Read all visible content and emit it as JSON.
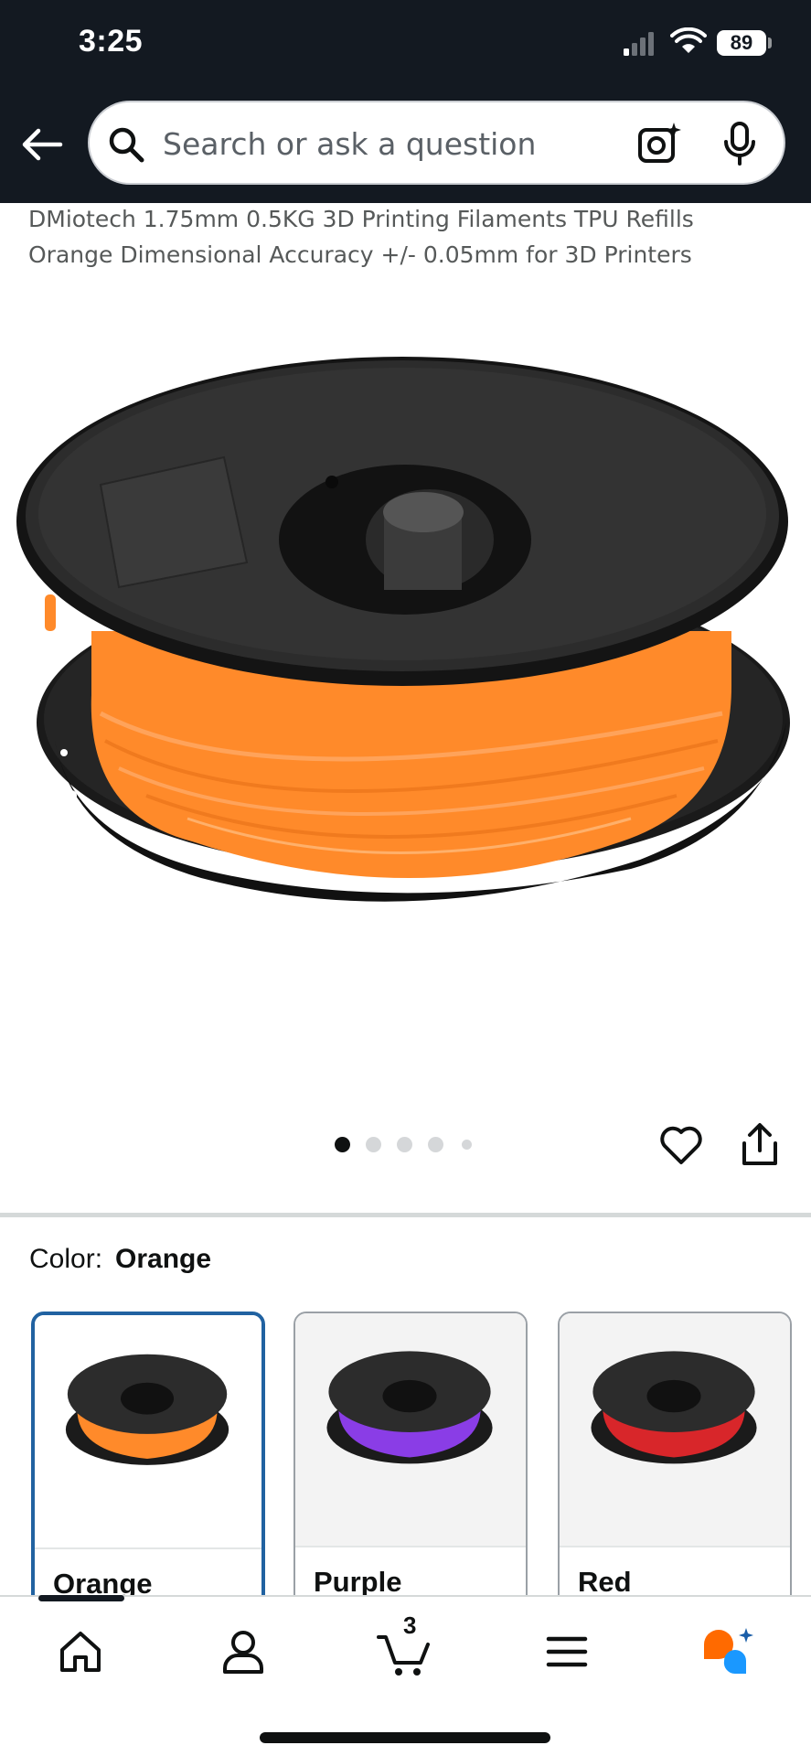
{
  "status_bar": {
    "time": "3:25",
    "battery": "89"
  },
  "search": {
    "placeholder": "Search or ask a question",
    "value": ""
  },
  "product": {
    "title_line1": "DMiotech 1.75mm 0.5KG 3D Printing Filaments TPU Refills",
    "title_line2": "Orange Dimensional Accuracy +/- 0.05mm for 3D Printers",
    "image_count": 5,
    "current_image_index": 0
  },
  "color_selector": {
    "label": "Color:",
    "selected": "Orange",
    "options": [
      {
        "label": "Orange",
        "color": "#ff8a2a",
        "selected": true
      },
      {
        "label": "Purple",
        "color": "#8a3de6",
        "selected": false
      },
      {
        "label": "Red",
        "color": "#d8262a",
        "selected": false
      }
    ]
  },
  "bottom_nav": {
    "items": [
      "home-icon",
      "account-icon",
      "cart-icon",
      "menu-icon",
      "rufus-assistant-icon"
    ],
    "cart_count": "3"
  },
  "colors": {
    "header_bg": "#131921",
    "selected_border": "#2162a1",
    "assistant_orange": "#ff6a00",
    "assistant_blue": "#1a98ff"
  }
}
